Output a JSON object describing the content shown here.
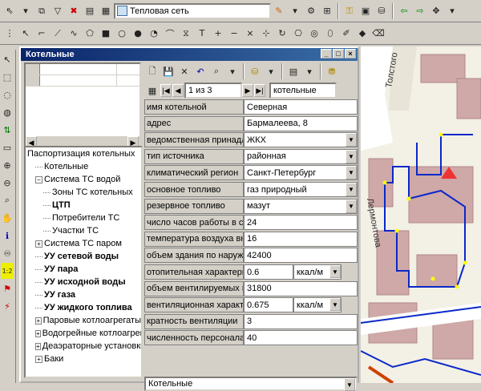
{
  "toolbar": {
    "layer_combo_value": "Тепловая сеть"
  },
  "panel": {
    "title": "Котельные"
  },
  "tree": {
    "items": [
      {
        "label": "Паспортизация котельных",
        "level": 0,
        "bold": false
      },
      {
        "label": "Котельные",
        "level": 1,
        "bold": false
      },
      {
        "label": "Система ТС водой",
        "level": 1,
        "bold": false,
        "expander": "−"
      },
      {
        "label": "Зоны ТС котельных",
        "level": 2,
        "bold": false
      },
      {
        "label": "ЦТП",
        "level": 2,
        "bold": true
      },
      {
        "label": "Потребители ТС",
        "level": 2,
        "bold": false
      },
      {
        "label": "Участки ТС",
        "level": 2,
        "bold": false
      },
      {
        "label": "Система ТС паром",
        "level": 1,
        "bold": false,
        "expander": "+"
      },
      {
        "label": "УУ сетевой воды",
        "level": 1,
        "bold": true
      },
      {
        "label": "УУ пара",
        "level": 1,
        "bold": true
      },
      {
        "label": "УУ исходной воды",
        "level": 1,
        "bold": true
      },
      {
        "label": "УУ газа",
        "level": 1,
        "bold": true
      },
      {
        "label": "УУ жидкого топлива",
        "level": 1,
        "bold": true
      },
      {
        "label": "Паровые котлоагрегаты",
        "level": 1,
        "bold": false,
        "expander": "+"
      },
      {
        "label": "Водогрейные котлоагрегаты",
        "level": 1,
        "bold": false,
        "expander": "+"
      },
      {
        "label": "Деаэраторные установки",
        "level": 1,
        "bold": false,
        "expander": "+"
      },
      {
        "label": "Баки",
        "level": 1,
        "bold": false,
        "expander": "+"
      }
    ]
  },
  "record_nav": {
    "position": "1 из 3",
    "table_name": "котельные"
  },
  "fields": [
    {
      "label": "имя котельной",
      "value": "Северная",
      "dropdown": false
    },
    {
      "label": "адрес",
      "value": "Бармалеева, 8",
      "dropdown": false
    },
    {
      "label": "ведомственная принадл",
      "value": "ЖКХ",
      "dropdown": true
    },
    {
      "label": "тип источника",
      "value": "районная",
      "dropdown": true
    },
    {
      "label": "климатический регион",
      "value": "Санкт-Петербург",
      "dropdown": true
    },
    {
      "label": "основное топливо",
      "value": "газ природный",
      "dropdown": true
    },
    {
      "label": "резервное топливо",
      "value": "мазут",
      "dropdown": true
    },
    {
      "label": "число часов работы в су",
      "value": "24",
      "dropdown": false
    },
    {
      "label": "температура воздуха вн",
      "value": "16",
      "dropdown": false
    },
    {
      "label": "объем здания по наружн",
      "value": "42400",
      "dropdown": false
    },
    {
      "label": "отопительная характери",
      "value": "0.6",
      "dropdown": false,
      "unit": "ккал/м"
    },
    {
      "label": "объем вентилируемых п",
      "value": "31800",
      "dropdown": false
    },
    {
      "label": "вентиляционная характе",
      "value": "0.675",
      "dropdown": false,
      "unit": "ккал/м"
    },
    {
      "label": "кратность вентиляции",
      "value": "3",
      "dropdown": false
    },
    {
      "label": "численность персонала",
      "value": "40",
      "dropdown": false
    }
  ],
  "status": {
    "text": "Котельные"
  },
  "map": {
    "street1": "Толстого",
    "street2": "Лермонтова"
  }
}
